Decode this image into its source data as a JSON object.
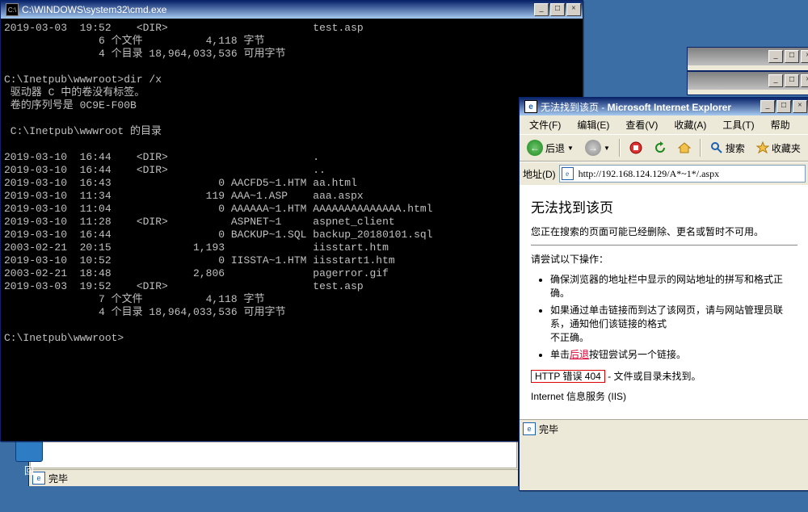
{
  "cmd": {
    "title": "C:\\WINDOWS\\system32\\cmd.exe",
    "lines": [
      "2019-03-03  19:52    <DIR>                       test.asp",
      "               6 个文件          4,118 字节",
      "               4 个目录 18,964,033,536 可用字节",
      "",
      "C:\\Inetpub\\wwwroot>dir /x",
      " 驱动器 C 中的卷没有标签。",
      " 卷的序列号是 0C9E-F00B",
      "",
      " C:\\Inetpub\\wwwroot 的目录",
      "",
      "2019-03-10  16:44    <DIR>                       .",
      "2019-03-10  16:44    <DIR>                       ..",
      "2019-03-10  16:43                 0 AACFD5~1.HTM aa.html",
      "2019-03-10  11:34               119 AAA~1.ASP    aaa.aspx",
      "2019-03-10  11:04                 0 AAAAAA~1.HTM AAAAAAAAAAAAAA.html",
      "2019-03-10  11:28    <DIR>          ASPNET~1     aspnet_client",
      "2019-03-10  16:44                 0 BACKUP~1.SQL backup_20180101.sql",
      "2003-02-21  20:15             1,193              iisstart.htm",
      "2019-03-10  10:52                 0 IISSTA~1.HTM iisstart1.htm",
      "2003-02-21  18:48             2,806              pagerror.gif",
      "2019-03-03  19:52    <DIR>                       test.asp",
      "               7 个文件          4,118 字节",
      "               4 个目录 18,964,033,536 可用字节",
      "",
      "C:\\Inetpub\\wwwroot>"
    ]
  },
  "ie": {
    "title_prefix": "无法找到该页 - ",
    "title_app": "Microsoft Internet Explorer",
    "menu": {
      "file": "文件(F)",
      "edit": "编辑(E)",
      "view": "查看(V)",
      "fav": "收藏(A)",
      "tools": "工具(T)",
      "help": "帮助"
    },
    "toolbar": {
      "back": "后退",
      "search": "搜索",
      "fav": "收藏夹"
    },
    "address_label": "地址(D)",
    "url": "http://192.168.124.129/A*~1*/.aspx",
    "page": {
      "h2": "无法找到该页",
      "p1": "您正在搜索的页面可能已经删除、更名或暂时不可用。",
      "p2": "请尝试以下操作：",
      "li1": "确保浏览器的地址栏中显示的网站地址的拼写和格式正确。",
      "li2a": "如果通过单击链接而到达了该网页，请与网站管理员联系，通知他们该链接的格式",
      "li2b": "不正确。",
      "li3a": "单击",
      "li3_link": "后退",
      "li3b": "按钮尝试另一个链接。",
      "err_box": "HTTP 错误 404",
      "err_tail": " - 文件或目录未找到。",
      "iis": "Internet 信息服务 (IIS)"
    },
    "status": "完毕"
  },
  "bg_status": "完毕",
  "desk_icon_label": "回"
}
